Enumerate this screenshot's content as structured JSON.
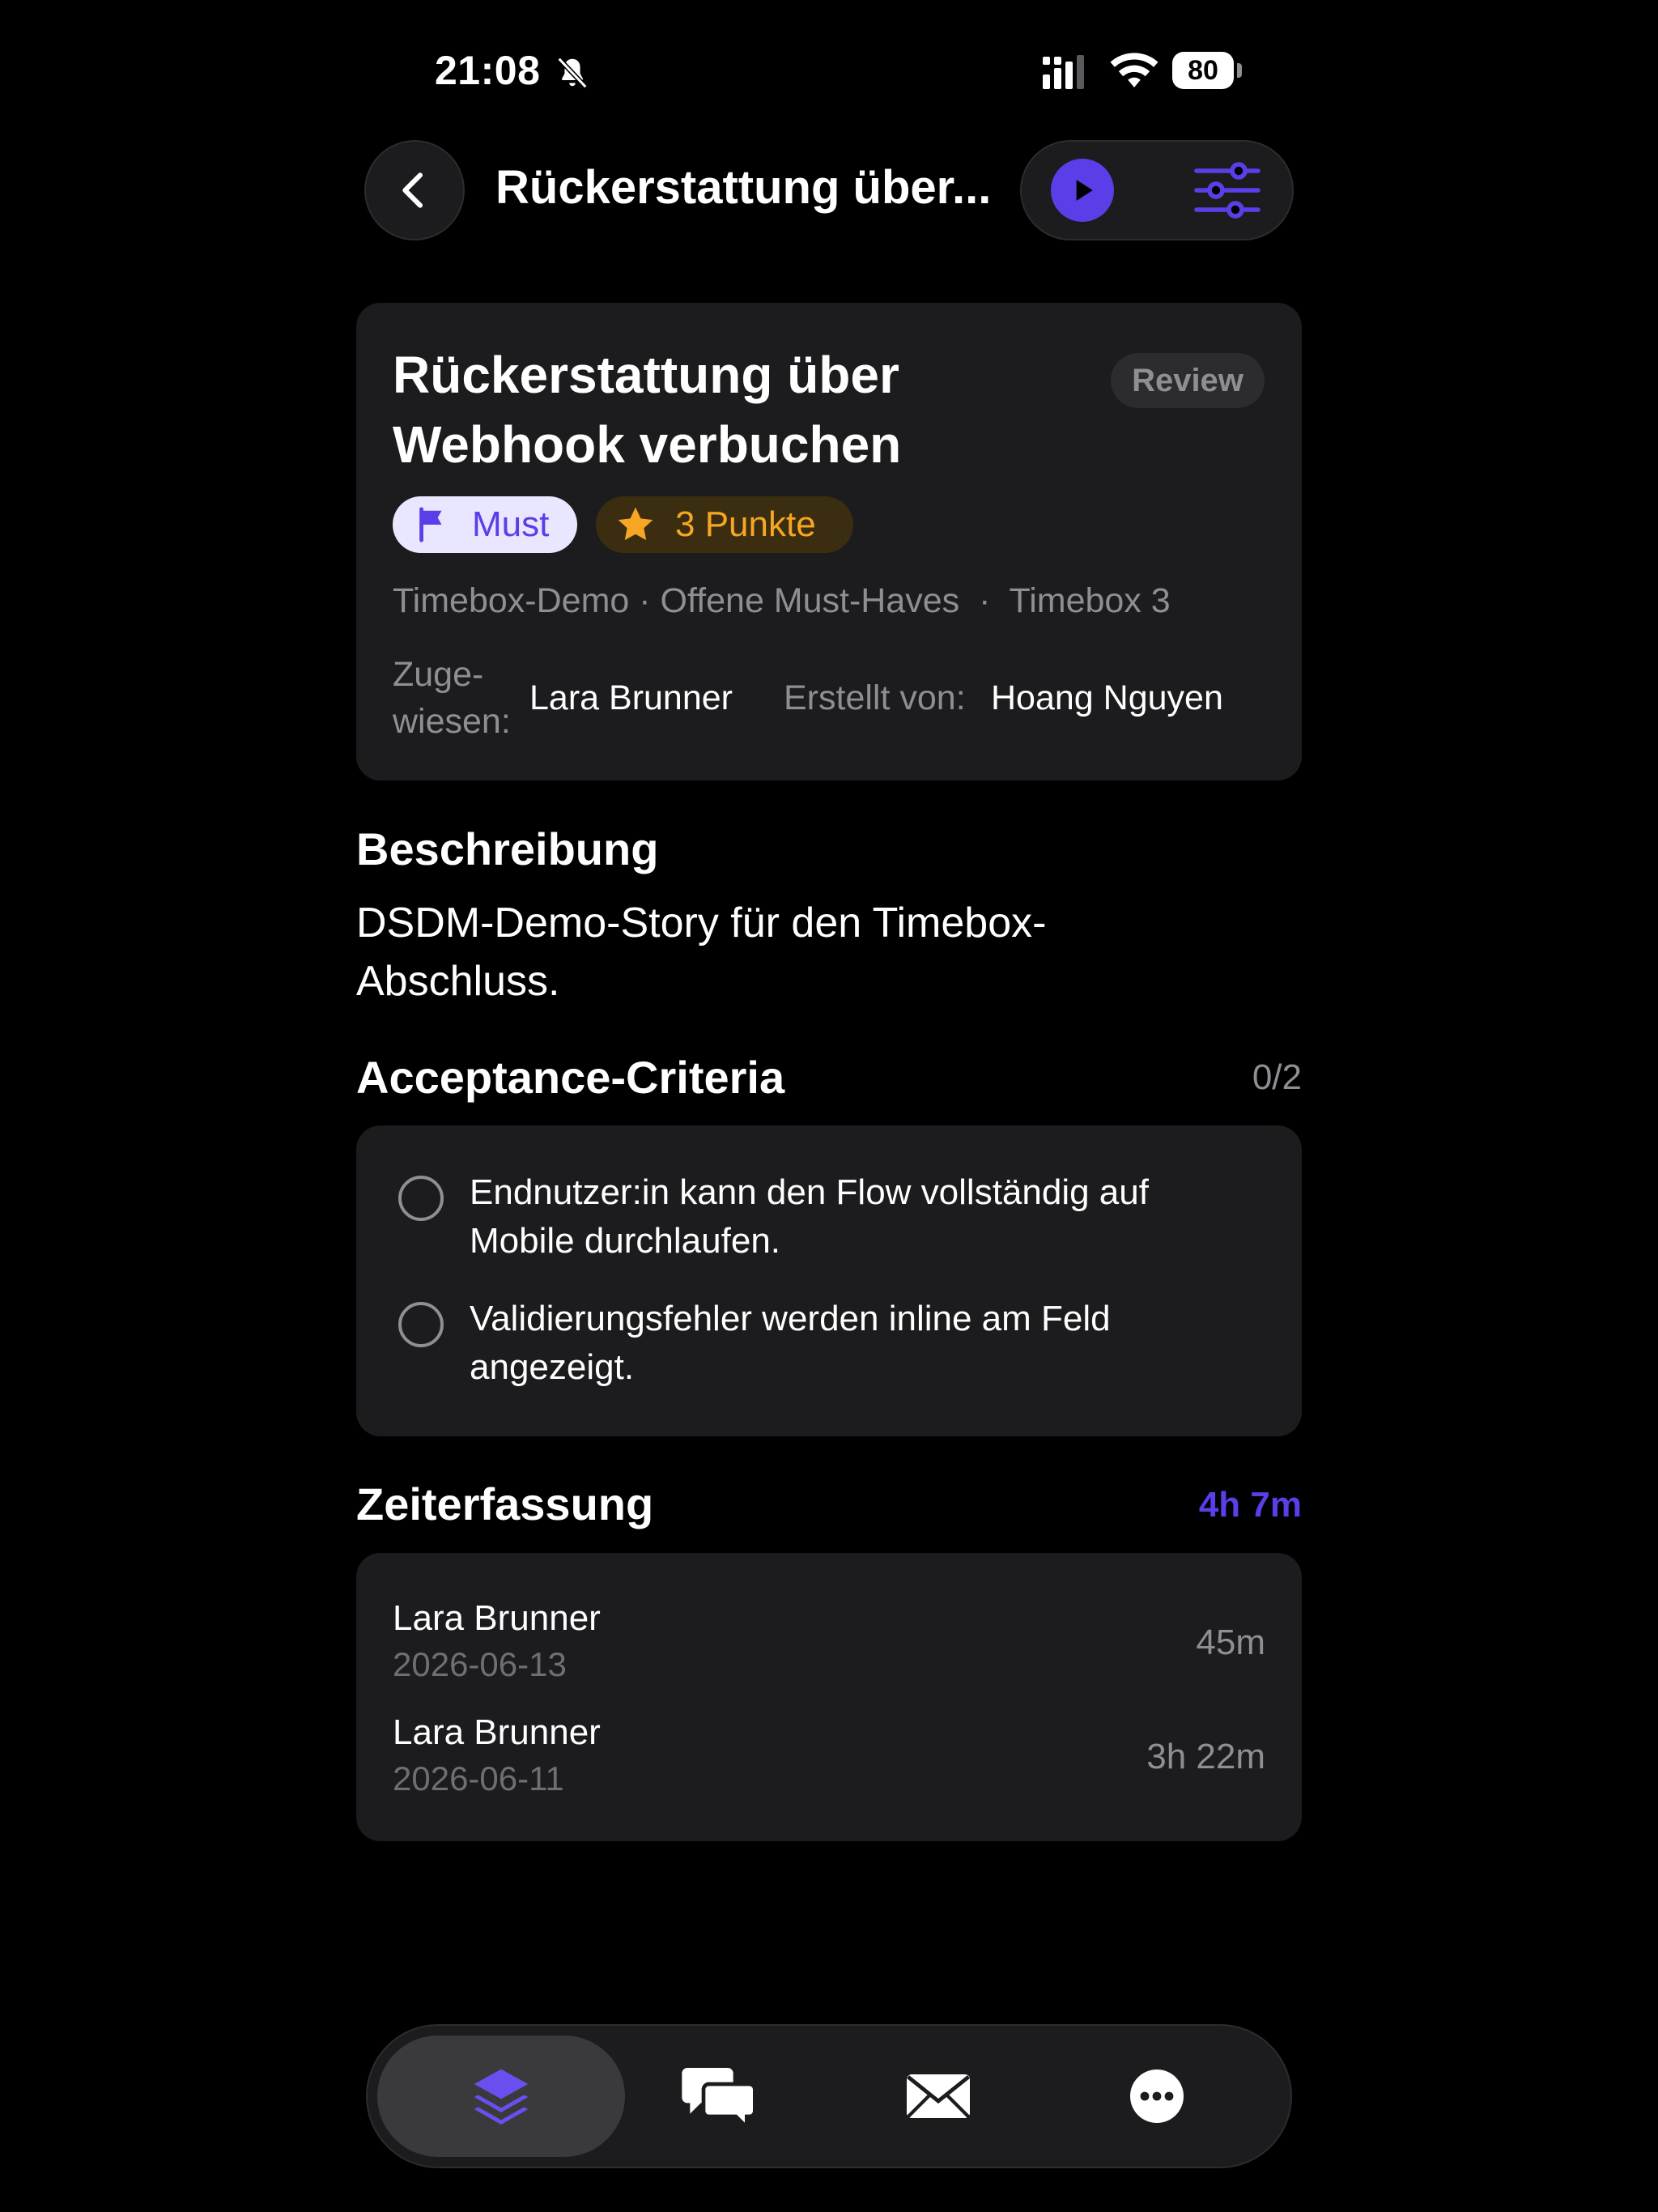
{
  "status_bar": {
    "time": "21:08",
    "battery": "80"
  },
  "header": {
    "title": "Rückerstattung über..."
  },
  "story": {
    "title": "Rückerstattung über Webhook verbuchen",
    "status": "Review",
    "priority": "Must",
    "points": "3 Punkte",
    "project": "Timebox-Demo",
    "group": "Offene Must-Haves",
    "timebox": "Timebox 3",
    "meta_separator1": "·",
    "meta_separator2": "·",
    "assigned_label": "Zuge-\nwiesen:",
    "assigned_name": "Lara Brunner",
    "created_label": "Erstellt von:",
    "created_name": "Hoang Nguyen"
  },
  "description": {
    "title": "Beschreibung",
    "text": "DSDM-Demo-Story für den Timebox-\nAbschluss."
  },
  "acceptance": {
    "title": "Acceptance-Criteria",
    "count": "0/2",
    "items": [
      {
        "text": "Endnutzer:in kann den Flow vollständig auf\nMobile durchlaufen.",
        "done": false
      },
      {
        "text": "Validierungsfehler werden inline am Feld\nangezeigt.",
        "done": false
      }
    ]
  },
  "time_tracking": {
    "title": "Zeiterfassung",
    "total": "4h 7m",
    "entries": [
      {
        "name": "Lara Brunner",
        "date": "2026-06-13",
        "duration": "45m"
      },
      {
        "name": "Lara Brunner",
        "date": "2026-06-11",
        "duration": "3h 22m"
      }
    ]
  },
  "tab_bar": {
    "tabs": [
      {
        "icon": "layers-icon",
        "active": true
      },
      {
        "icon": "chat-bubbles-icon",
        "active": false
      },
      {
        "icon": "envelope-icon",
        "active": false
      },
      {
        "icon": "more-icon",
        "active": false
      }
    ]
  },
  "colors": {
    "accent": "#5b3ee8",
    "points": "#f6a623",
    "card": "#1c1c1e"
  }
}
